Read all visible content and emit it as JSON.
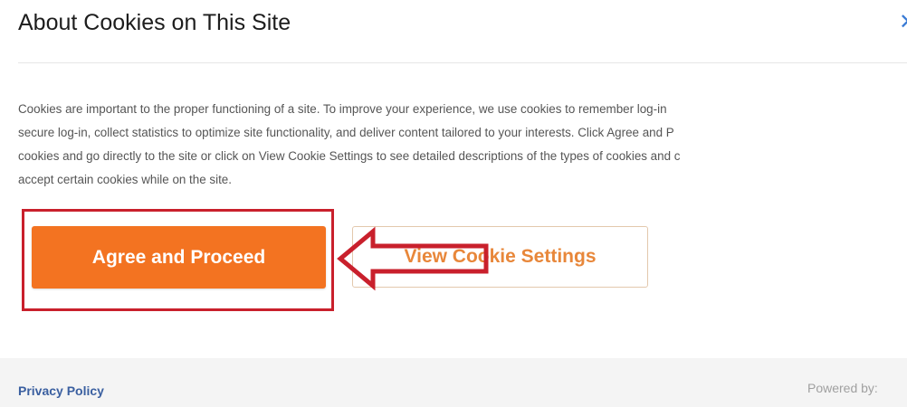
{
  "dialog": {
    "title": "About Cookies on This Site",
    "close_glyph": "✕",
    "description_lines": [
      "Cookies are important to the proper functioning of a site. To improve your experience, we use cookies to remember log-in",
      "secure log-in, collect statistics to optimize site functionality, and deliver content tailored to your interests. Click Agree and P",
      "cookies and go directly to the site or click on View Cookie Settings to see detailed descriptions of the types of cookies and c",
      "accept certain cookies while on the site."
    ],
    "buttons": {
      "agree_label": "Agree and Proceed",
      "settings_label": "View Cookie Settings"
    }
  },
  "footer": {
    "privacy_label": "Privacy Policy",
    "powered_by": "Powered by:"
  },
  "annotations": {
    "highlight_color": "#c9202c",
    "arrow_icon": "left-arrow-icon"
  },
  "colors": {
    "accent": "#f37321",
    "link": "#3a5fa0"
  }
}
